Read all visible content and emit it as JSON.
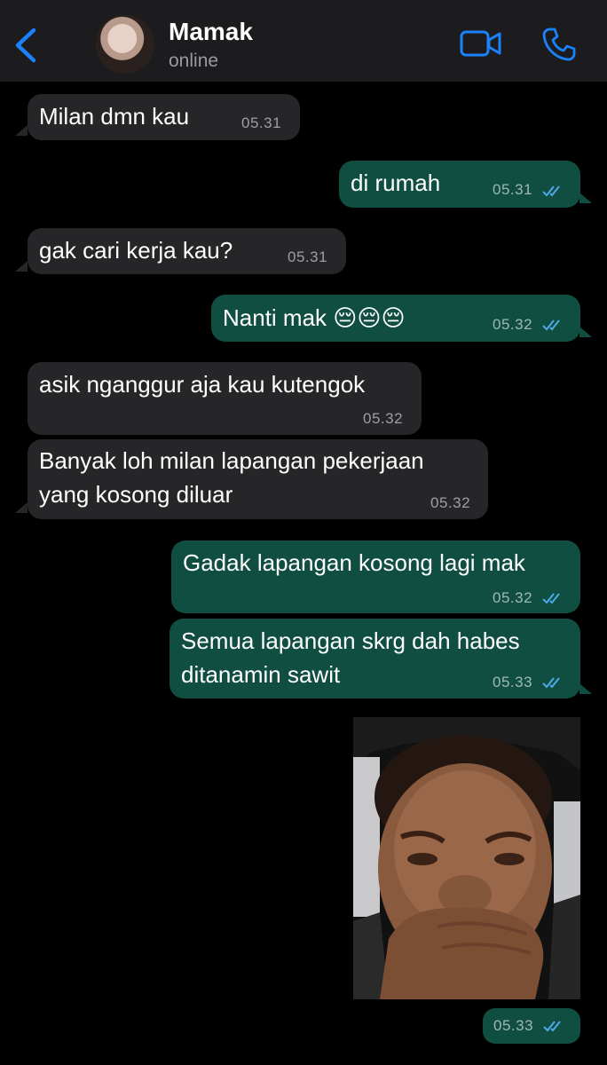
{
  "header": {
    "contact_name": "Mamak",
    "status": "online",
    "accent_color": "#1a82fb",
    "icons": [
      "back-chevron-icon",
      "video-call-icon",
      "phone-call-icon"
    ]
  },
  "messages": [
    {
      "direction": "in",
      "text": "Milan dmn kau",
      "time": "05.31"
    },
    {
      "direction": "out",
      "text": "di rumah",
      "time": "05.31",
      "read": true
    },
    {
      "direction": "in",
      "text": "gak cari kerja kau?",
      "time": "05.31"
    },
    {
      "direction": "out",
      "text": "Nanti mak 😔😔😔",
      "time": "05.32",
      "read": true
    },
    {
      "direction": "in",
      "text": "asik nganggur aja kau kutengok",
      "time": "05.32"
    },
    {
      "direction": "in",
      "lines": [
        "Banyak loh milan lapangan pekerjaan",
        "yang kosong diluar"
      ],
      "time": "05.32"
    },
    {
      "direction": "out",
      "text": "Gadak lapangan kosong lagi mak",
      "time": "05.32",
      "read": true
    },
    {
      "direction": "out",
      "lines": [
        "Semua lapangan skrg dah habes",
        "ditanamin sawit"
      ],
      "time": "05.33",
      "read": true
    },
    {
      "direction": "out",
      "type": "photo",
      "time": "05.33",
      "read": true
    }
  ],
  "colors": {
    "incoming_bubble": "#262628",
    "outgoing_bubble": "#0f4e41",
    "read_ticks": "#4fa9e8",
    "background": "#000000"
  }
}
